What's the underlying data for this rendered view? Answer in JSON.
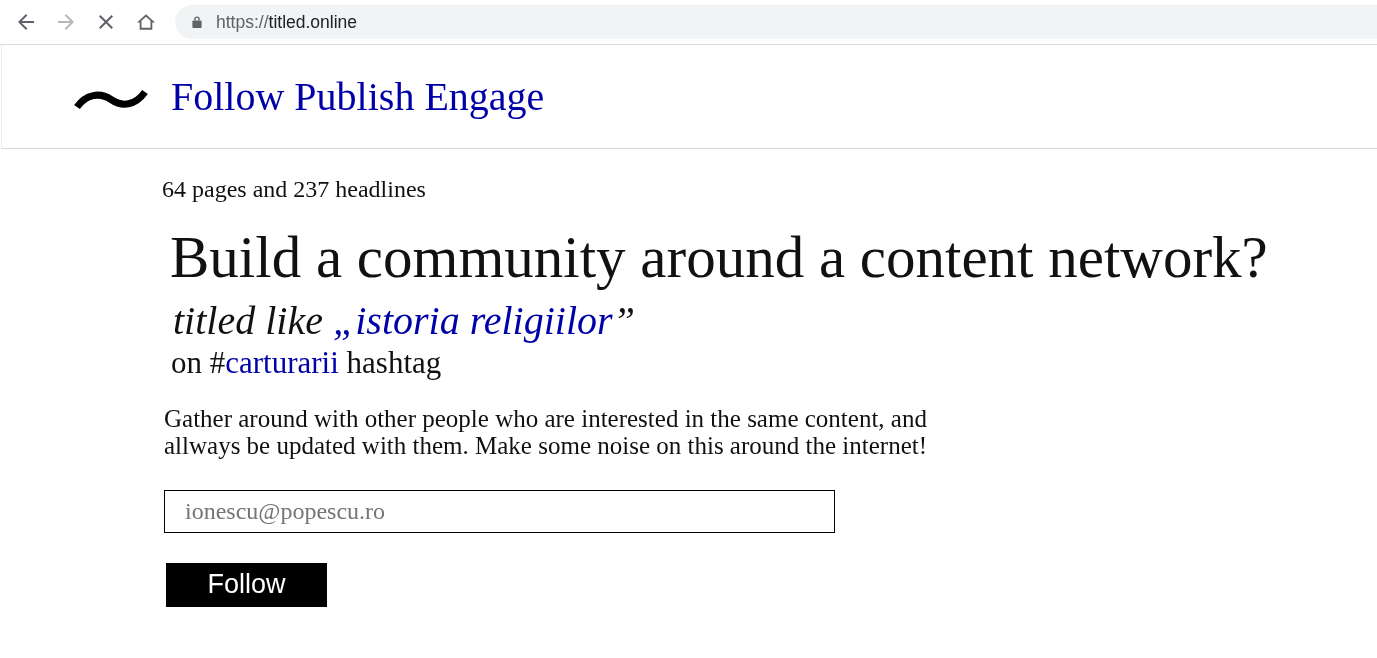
{
  "browser": {
    "nav_buttons": [
      {
        "kind": "back",
        "disabled": false
      },
      {
        "kind": "forward",
        "disabled": true
      },
      {
        "kind": "stop",
        "disabled": false
      },
      {
        "kind": "home",
        "disabled": false
      }
    ],
    "url": {
      "scheme": "https://",
      "host": "titled.online"
    }
  },
  "header": {
    "title": "Follow Publish Engage"
  },
  "stats": "64 pages and 237 headlines",
  "headline": "Build a community around a content network?",
  "subtitle": {
    "prefix": "titled like ",
    "link": "„istoria religiilor",
    "suffix": "”"
  },
  "hashtag_line": {
    "prefix": "on #",
    "link": "carturarii",
    "suffix": " hashtag"
  },
  "description": "Gather around with other people who are interested in the same content, and allways be updated with them. Make some noise on this around the internet!",
  "email_field": {
    "placeholder": "ionescu@popescu.ro"
  },
  "follow_button": {
    "label": "Follow"
  }
}
